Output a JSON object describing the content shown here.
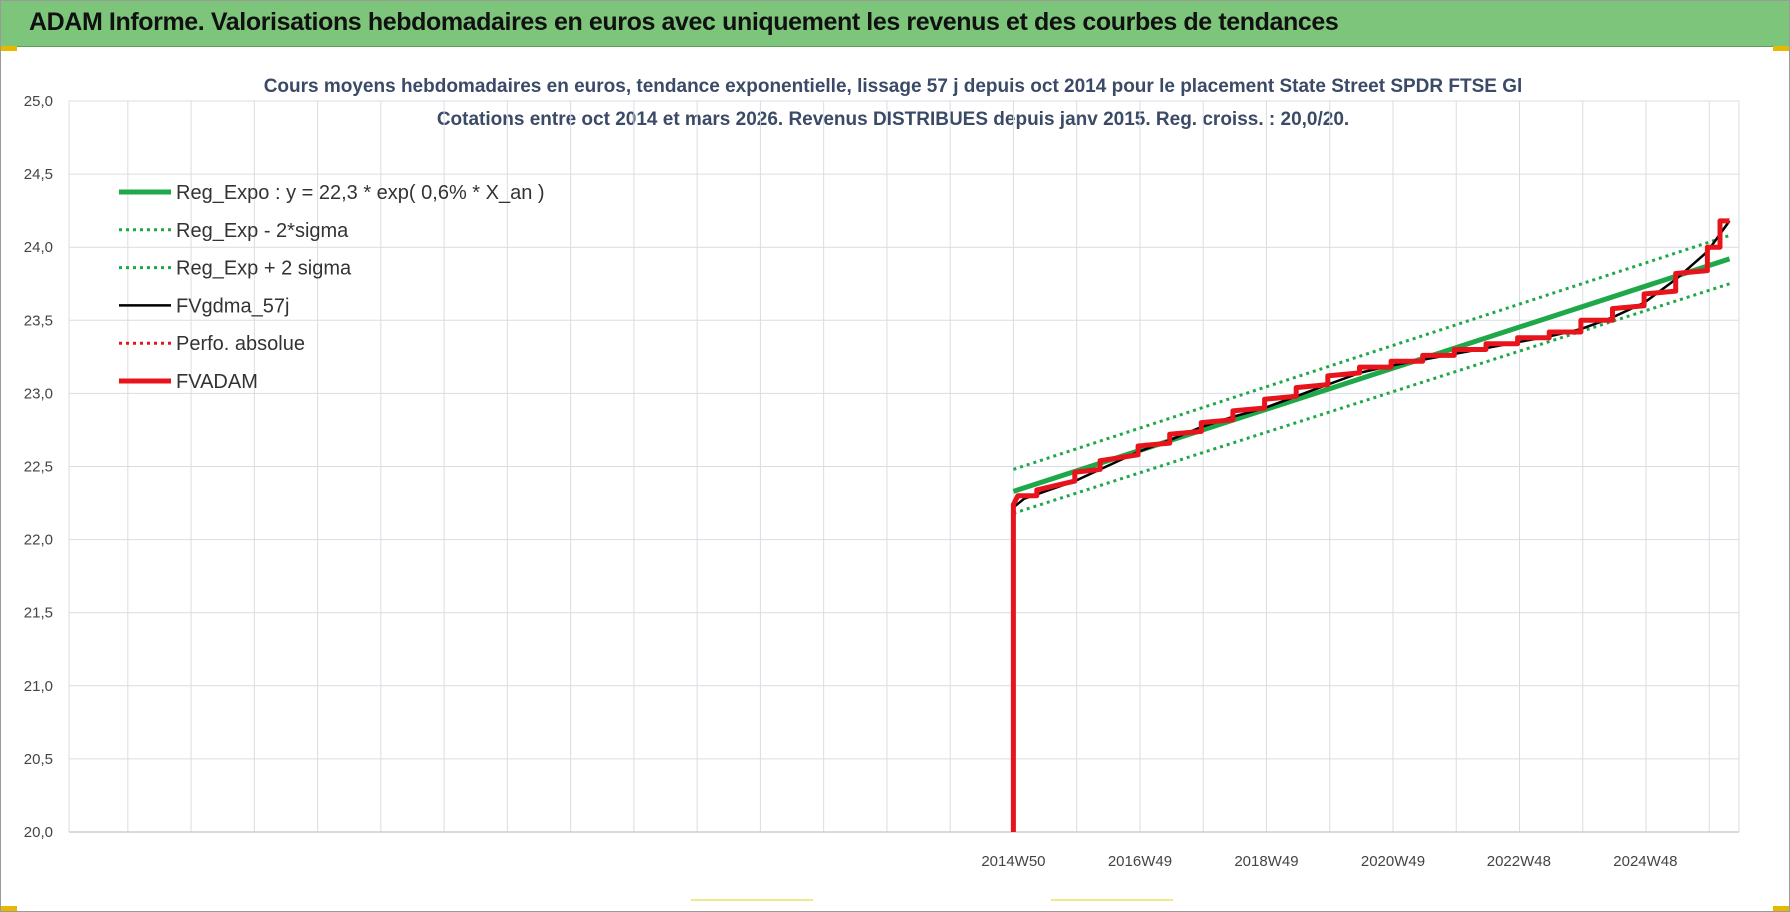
{
  "banner": {
    "title": "ADAM Informe. Valorisations hebdomadaires en euros avec uniquement les revenus et des courbes de tendances"
  },
  "colors": {
    "banner": "#7dc57a",
    "reg_expo": "#1fa84a",
    "fvgdma": "#000000",
    "fvadam": "#e8141c",
    "perfo": "#e8141c",
    "grid": "#d9dde3"
  },
  "chart_data": {
    "type": "line",
    "title": "Cours moyens hebdomadaires en euros, tendance exponentielle, lissage 57 j depuis oct 2014 pour le placement State Street SPDR FTSE Gl",
    "subtitle": "Cotations entre oct 2014 et mars 2026. Revenus DISTRIBUES depuis janv 2015. Reg. croiss. : 20,0/20.",
    "ylim": [
      20.0,
      25.0
    ],
    "y_ticks": [
      "20,0",
      "20,5",
      "21,0",
      "21,5",
      "22,0",
      "22,5",
      "23,0",
      "23,5",
      "24,0",
      "24,5",
      "25,0"
    ],
    "x_tick_labels": [
      "2014W50",
      "2016W49",
      "2018W49",
      "2020W49",
      "2022W48",
      "2024W48"
    ],
    "x_tick_positions_years": [
      2014.93,
      2016.93,
      2018.93,
      2020.93,
      2022.92,
      2024.92
    ],
    "xlim_years": [
      2000.0,
      2026.4
    ],
    "grid": true,
    "legend_position": "top-left",
    "series": [
      {
        "name": "Reg_Expo : y = 22,3 * exp( 0,6% *  X_an )",
        "style": "solid-thick",
        "color": "#1fa84a",
        "x": [
          2014.93,
          2026.25
        ],
        "y": [
          22.33,
          23.92
        ]
      },
      {
        "name": "Reg_Exp - 2*sigma",
        "style": "dotted",
        "color": "#1fa84a",
        "x": [
          2014.93,
          2026.25
        ],
        "y": [
          22.18,
          23.75
        ]
      },
      {
        "name": "Reg_Exp + 2 sigma",
        "style": "dotted",
        "color": "#1fa84a",
        "x": [
          2014.93,
          2026.25
        ],
        "y": [
          22.48,
          24.08
        ]
      },
      {
        "name": "FVgdma_57j",
        "style": "solid",
        "color": "#000000",
        "x": [
          2014.93,
          2015.1,
          2015.9,
          2016.4,
          2016.9,
          2017.4,
          2017.9,
          2018.4,
          2018.9,
          2019.4,
          2019.9,
          2020.4,
          2020.9,
          2021.4,
          2021.9,
          2022.4,
          2022.9,
          2023.4,
          2023.9,
          2024.4,
          2024.9,
          2025.4,
          2025.9,
          2026.25
        ],
        "y": [
          22.22,
          22.28,
          22.4,
          22.5,
          22.6,
          22.68,
          22.77,
          22.84,
          22.9,
          22.98,
          23.06,
          23.14,
          23.19,
          23.23,
          23.27,
          23.31,
          23.35,
          23.39,
          23.44,
          23.52,
          23.62,
          23.78,
          23.97,
          24.18
        ]
      },
      {
        "name": "Perfo. absolue",
        "style": "dotted",
        "color": "#e8141c",
        "x": [],
        "y": []
      },
      {
        "name": "FVADAM",
        "style": "solid-thick",
        "color": "#e8141c",
        "x": [
          2014.93,
          2014.93,
          2015.0,
          2015.3,
          2015.3,
          2015.9,
          2015.9,
          2016.3,
          2016.3,
          2016.9,
          2016.9,
          2017.4,
          2017.4,
          2017.9,
          2017.9,
          2018.4,
          2018.4,
          2018.9,
          2018.9,
          2019.4,
          2019.4,
          2019.9,
          2019.9,
          2020.4,
          2020.4,
          2020.9,
          2020.9,
          2021.4,
          2021.4,
          2021.9,
          2021.9,
          2022.4,
          2022.4,
          2022.9,
          2022.9,
          2023.4,
          2023.4,
          2023.9,
          2023.9,
          2024.4,
          2024.4,
          2024.9,
          2024.9,
          2025.4,
          2025.4,
          2025.9,
          2025.9,
          2026.1,
          2026.1,
          2026.25
        ],
        "y": [
          20.0,
          22.24,
          22.3,
          22.3,
          22.34,
          22.4,
          22.46,
          22.48,
          22.54,
          22.58,
          22.64,
          22.66,
          22.72,
          22.74,
          22.8,
          22.82,
          22.88,
          22.9,
          22.96,
          22.98,
          23.04,
          23.06,
          23.12,
          23.14,
          23.18,
          23.18,
          23.22,
          23.22,
          23.26,
          23.26,
          23.3,
          23.3,
          23.34,
          23.34,
          23.38,
          23.38,
          23.42,
          23.42,
          23.5,
          23.5,
          23.58,
          23.6,
          23.68,
          23.7,
          23.82,
          23.84,
          24.0,
          24.0,
          24.18,
          24.18
        ]
      }
    ]
  }
}
